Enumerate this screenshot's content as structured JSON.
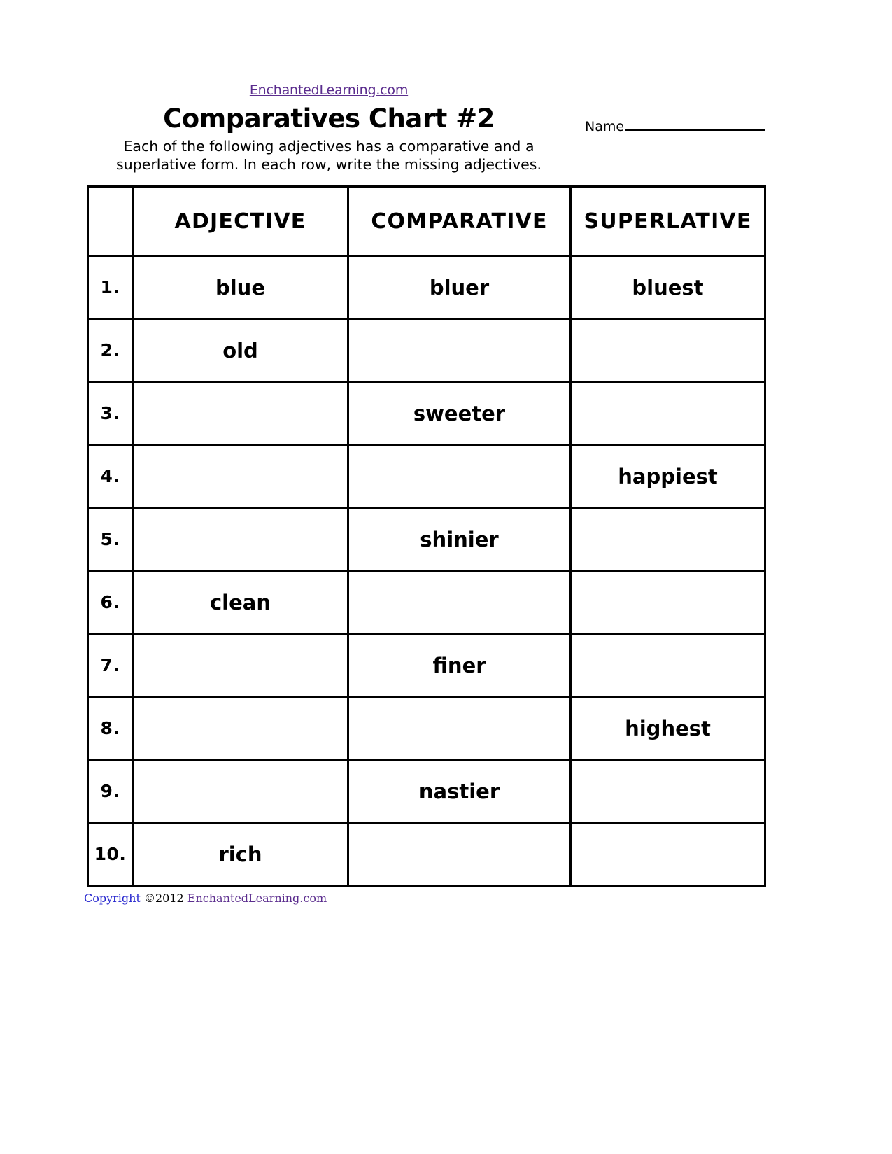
{
  "header": {
    "site_link": "EnchantedLearning.com",
    "title": "Comparatives Chart #2",
    "instructions": "Each of the following adjectives has a comparative and a superlative form. In each row, write the missing adjectives.",
    "name_label": "Name"
  },
  "table": {
    "columns": [
      "",
      "ADJECTIVE",
      "COMPARATIVE",
      "SUPERLATIVE"
    ],
    "rows": [
      {
        "num": "1.",
        "adjective": "blue",
        "comparative": "bluer",
        "superlative": "bluest"
      },
      {
        "num": "2.",
        "adjective": "old",
        "comparative": "",
        "superlative": ""
      },
      {
        "num": "3.",
        "adjective": "",
        "comparative": "sweeter",
        "superlative": ""
      },
      {
        "num": "4.",
        "adjective": "",
        "comparative": "",
        "superlative": "happiest"
      },
      {
        "num": "5.",
        "adjective": "",
        "comparative": "shinier",
        "superlative": ""
      },
      {
        "num": "6.",
        "adjective": "clean",
        "comparative": "",
        "superlative": ""
      },
      {
        "num": "7.",
        "adjective": "",
        "comparative": "finer",
        "superlative": ""
      },
      {
        "num": "8.",
        "adjective": "",
        "comparative": "",
        "superlative": "highest"
      },
      {
        "num": "9.",
        "adjective": "",
        "comparative": "nastier",
        "superlative": ""
      },
      {
        "num": "10.",
        "adjective": "rich",
        "comparative": "",
        "superlative": ""
      }
    ]
  },
  "footer": {
    "copyright_word": "Copyright",
    "copyright_mid": " ©2012 ",
    "copyright_site": "EnchantedLearning.com"
  },
  "colors": {
    "link_purple": "#5b2d8e",
    "link_blue": "#2727cf",
    "border": "#000000",
    "text": "#000000"
  }
}
